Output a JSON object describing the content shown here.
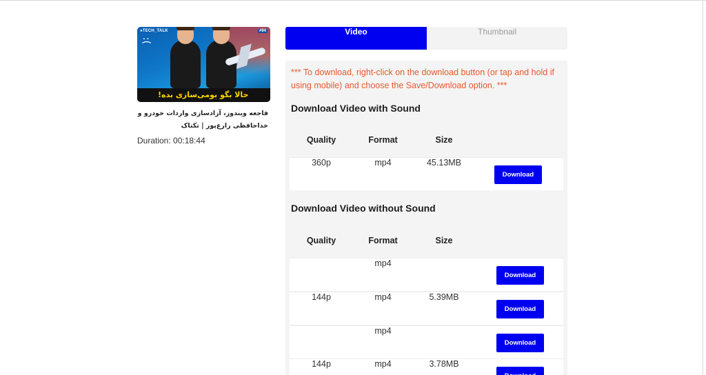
{
  "media": {
    "thumbnail_channel_tag": "●TECH_TALK",
    "thumbnail_episode": "#94",
    "thumbnail_banner": "حالا بگو بومی‌سازی بده!",
    "title": "فاجعه ویندوز، آزادسازی واردات خودرو و خداحافظی زارع‌پور | تکتاک",
    "duration": "Duration: 00:18:44"
  },
  "tabs": [
    {
      "label": "Video",
      "active": true
    },
    {
      "label": "Thumbnail",
      "active": false
    }
  ],
  "notice": "*** To download, right-click on the download button (or tap and hold if using mobile) and choose the Save/Download option. ***",
  "with_sound": {
    "title": "Download Video with Sound",
    "headers": {
      "quality": "Quality",
      "format": "Format",
      "size": "Size"
    },
    "rows": [
      {
        "quality": "360p",
        "format": "mp4",
        "size": "45.13MB",
        "action": "Download"
      }
    ]
  },
  "without_sound": {
    "title": "Download Video without Sound",
    "headers": {
      "quality": "Quality",
      "format": "Format",
      "size": "Size"
    },
    "rows": [
      {
        "quality": "",
        "format": "mp4",
        "size": "",
        "action": "Download"
      },
      {
        "quality": "144p",
        "format": "mp4",
        "size": "5.39MB",
        "action": "Download"
      },
      {
        "quality": "",
        "format": "mp4",
        "size": "",
        "action": "Download"
      },
      {
        "quality": "144p",
        "format": "mp4",
        "size": "3.78MB",
        "action": "Download"
      }
    ]
  },
  "colors": {
    "accent": "#0000f0",
    "notice": "#e8582e",
    "panel": "#f4f4f4"
  }
}
